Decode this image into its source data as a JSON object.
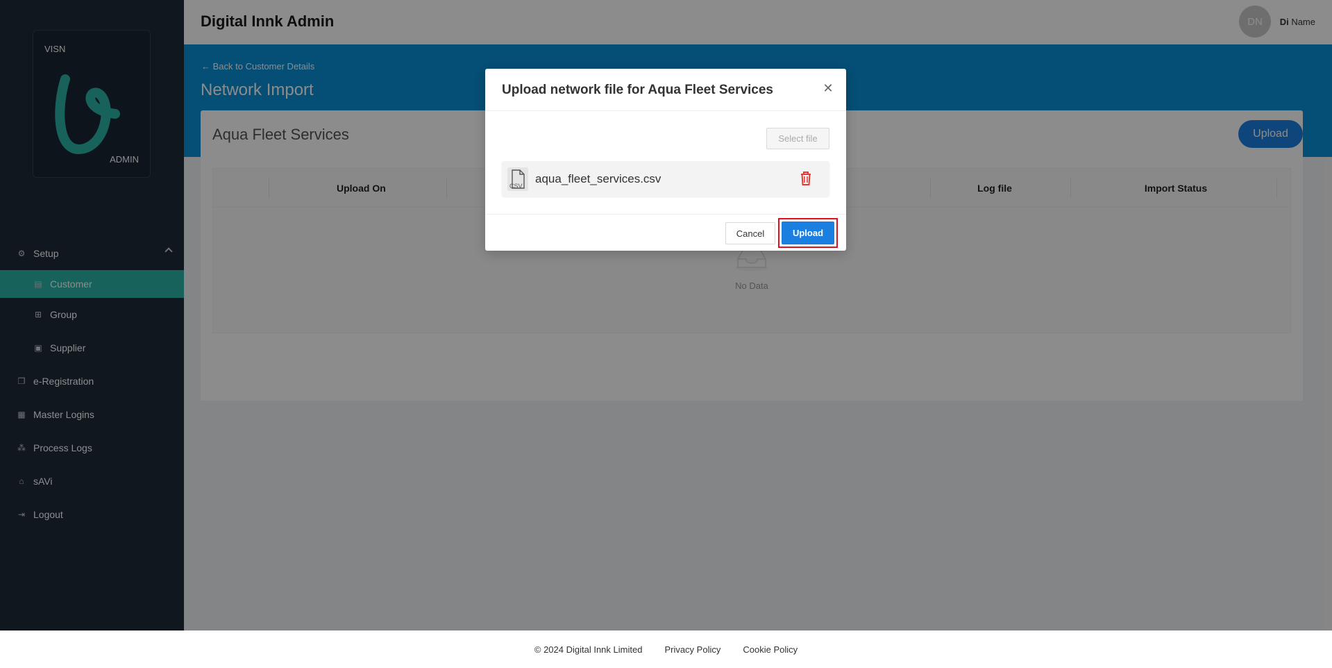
{
  "header": {
    "app_title": "Digital Innk Admin",
    "avatar_initials": "DN",
    "user_first": "Di",
    "user_last": "Name"
  },
  "logo": {
    "top_text": "VISN",
    "bottom_text": "ADMIN"
  },
  "sidebar": {
    "items": [
      {
        "label": "Setup",
        "icon": "gear-icon"
      },
      {
        "label": "Customer",
        "icon": "document-icon"
      },
      {
        "label": "Group",
        "icon": "hierarchy-icon"
      },
      {
        "label": "Supplier",
        "icon": "briefcase-icon"
      },
      {
        "label": "e-Registration",
        "icon": "copy-icon"
      },
      {
        "label": "Master Logins",
        "icon": "stack-icon"
      },
      {
        "label": "Process Logs",
        "icon": "nodes-icon"
      },
      {
        "label": "sAVi",
        "icon": "bank-icon"
      },
      {
        "label": "Logout",
        "icon": "logout-icon"
      }
    ]
  },
  "page": {
    "back_link": "Back to Customer Details",
    "title": "Network Import",
    "customer_name": "Aqua Fleet Services",
    "upload_button": "Upload"
  },
  "table": {
    "columns": [
      "Upload On",
      "Log file",
      "Import Status"
    ],
    "empty_text": "No Data"
  },
  "modal": {
    "title": "Upload network file for Aqua Fleet Services",
    "select_file": "Select file",
    "file_name": "aqua_fleet_services.csv",
    "file_ext": "CSV",
    "cancel": "Cancel",
    "upload": "Upload"
  },
  "footer": {
    "copyright": "© 2024 Digital Innk Limited",
    "privacy": "Privacy Policy",
    "cookie": "Cookie Policy"
  },
  "colors": {
    "sidebar": "#1f2a38",
    "accent_teal": "#2bb3a7",
    "band_blue": "#0a8fd6",
    "button_blue": "#1a7fe0",
    "highlight_red": "#e0111f"
  }
}
